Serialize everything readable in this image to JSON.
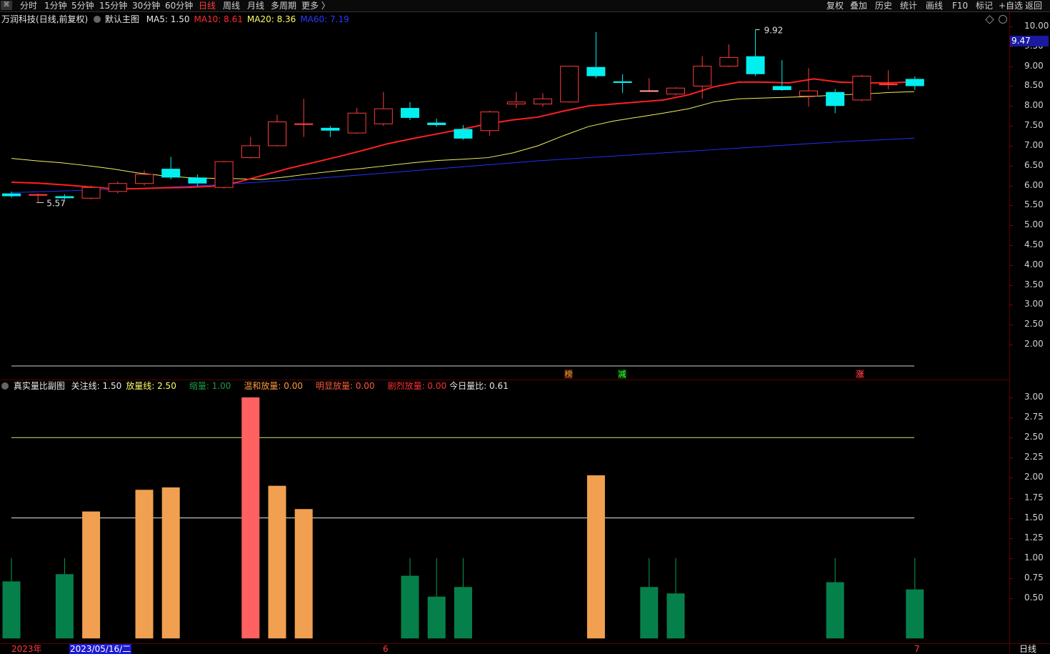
{
  "toolbar": {
    "logo": "⌘",
    "left_items": [
      "分时",
      "1分钟",
      "5分钟",
      "15分钟",
      "30分钟",
      "60分钟",
      "日线",
      "周线",
      "月线",
      "多周期",
      "更多"
    ],
    "active": "日线",
    "right_items": [
      "复权",
      "叠加",
      "历史",
      "统计",
      "画线",
      "F10",
      "标记",
      "+自选",
      "返回"
    ]
  },
  "main_chart": {
    "stock_name": "万润科技",
    "mode": "(日线,前复权)",
    "indicator_name": "默认主图",
    "ma_labels": [
      {
        "text": "MA5: 1.50",
        "color": "#e8e8e8"
      },
      {
        "text": "MA10: 8.61",
        "color": "#ff2b2b"
      },
      {
        "text": "MA20: 8.36",
        "color": "#ffff66"
      },
      {
        "text": "MA60: 7.19",
        "color": "#2a3aff"
      }
    ],
    "high_label": "9.92",
    "low_label": "5.57",
    "last_price_tag": "9.47",
    "y_axis": [
      "10.00",
      "9.50",
      "9.00",
      "8.50",
      "8.00",
      "7.50",
      "7.00",
      "6.50",
      "6.00",
      "5.50",
      "5.00",
      "4.50",
      "4.00",
      "3.50",
      "3.00",
      "2.50",
      "2.00"
    ],
    "signals": [
      {
        "text": "榜",
        "color": "#ff9a3c",
        "bg": "#3a1a00"
      },
      {
        "text": "减",
        "color": "#3cff3c",
        "bg": "#003a00"
      },
      {
        "text": "涨",
        "color": "#ff5a5a",
        "bg": "#3a0000"
      }
    ]
  },
  "chart_data": {
    "type": "candlestick",
    "ylim": [
      1.5,
      10.1
    ],
    "candles": [
      {
        "o": 5.8,
        "c": 5.73,
        "h": 5.85,
        "l": 5.7
      },
      {
        "o": 5.77,
        "c": 5.77,
        "h": 5.8,
        "l": 5.57
      },
      {
        "o": 5.73,
        "c": 5.68,
        "h": 5.78,
        "l": 5.65
      },
      {
        "o": 5.68,
        "c": 5.95,
        "h": 6.0,
        "l": 5.65
      },
      {
        "o": 5.85,
        "c": 6.05,
        "h": 6.1,
        "l": 5.8
      },
      {
        "o": 6.05,
        "c": 6.28,
        "h": 6.38,
        "l": 6.0
      },
      {
        "o": 6.42,
        "c": 6.2,
        "h": 6.72,
        "l": 6.15
      },
      {
        "o": 6.2,
        "c": 6.05,
        "h": 6.28,
        "l": 5.98
      },
      {
        "o": 5.95,
        "c": 6.6,
        "h": 6.62,
        "l": 5.92
      },
      {
        "o": 6.7,
        "c": 7.0,
        "h": 7.22,
        "l": 6.68
      },
      {
        "o": 7.0,
        "c": 7.6,
        "h": 7.78,
        "l": 6.98
      },
      {
        "o": 7.55,
        "c": 7.55,
        "h": 8.18,
        "l": 7.22
      },
      {
        "o": 7.45,
        "c": 7.38,
        "h": 7.5,
        "l": 7.22
      },
      {
        "o": 7.32,
        "c": 7.82,
        "h": 7.95,
        "l": 7.3
      },
      {
        "o": 7.55,
        "c": 7.93,
        "h": 8.35,
        "l": 7.5
      },
      {
        "o": 7.95,
        "c": 7.7,
        "h": 8.1,
        "l": 7.65
      },
      {
        "o": 7.58,
        "c": 7.52,
        "h": 7.68,
        "l": 7.48
      },
      {
        "o": 7.42,
        "c": 7.18,
        "h": 7.52,
        "l": 7.15
      },
      {
        "o": 7.38,
        "c": 7.85,
        "h": 7.88,
        "l": 7.25
      },
      {
        "o": 8.05,
        "c": 8.1,
        "h": 8.35,
        "l": 7.95
      },
      {
        "o": 8.05,
        "c": 8.18,
        "h": 8.32,
        "l": 7.98
      },
      {
        "o": 8.1,
        "c": 9.0,
        "h": 9.0,
        "l": 8.08
      },
      {
        "o": 8.98,
        "c": 8.75,
        "h": 9.86,
        "l": 8.7
      },
      {
        "o": 8.62,
        "c": 8.58,
        "h": 8.8,
        "l": 8.33
      },
      {
        "o": 8.38,
        "c": 8.38,
        "h": 8.7,
        "l": 8.38
      },
      {
        "o": 8.3,
        "c": 8.45,
        "h": 8.47,
        "l": 8.26
      },
      {
        "o": 8.5,
        "c": 9.0,
        "h": 9.25,
        "l": 8.18
      },
      {
        "o": 9.0,
        "c": 9.22,
        "h": 9.55,
        "l": 8.98
      },
      {
        "o": 9.25,
        "c": 8.8,
        "h": 9.92,
        "l": 8.75
      },
      {
        "o": 8.5,
        "c": 8.4,
        "h": 9.15,
        "l": 8.38
      },
      {
        "o": 8.25,
        "c": 8.38,
        "h": 8.95,
        "l": 7.98
      },
      {
        "o": 8.35,
        "c": 8.0,
        "h": 8.43,
        "l": 7.82
      },
      {
        "o": 8.15,
        "c": 8.75,
        "h": 8.78,
        "l": 8.12
      },
      {
        "o": 8.55,
        "c": 8.55,
        "h": 8.9,
        "l": 8.42
      },
      {
        "o": 8.68,
        "c": 8.5,
        "h": 8.75,
        "l": 8.4
      }
    ],
    "ma10": [
      6.08,
      6.06,
      6.02,
      5.97,
      5.92,
      5.92,
      5.94,
      5.95,
      5.98,
      6.08,
      6.25,
      6.42,
      6.57,
      6.72,
      6.88,
      7.05,
      7.18,
      7.3,
      7.42,
      7.55,
      7.65,
      7.72,
      7.87,
      8.0,
      8.05,
      8.1,
      8.15,
      8.28,
      8.48,
      8.6,
      8.6,
      8.58,
      8.68,
      8.6,
      8.58,
      8.58,
      8.61
    ],
    "ma20": [
      6.68,
      6.62,
      6.57,
      6.5,
      6.42,
      6.32,
      6.25,
      6.2,
      6.18,
      6.17,
      6.15,
      6.22,
      6.3,
      6.37,
      6.43,
      6.5,
      6.57,
      6.63,
      6.66,
      6.7,
      6.82,
      7.0,
      7.25,
      7.48,
      7.62,
      7.72,
      7.82,
      7.93,
      8.1,
      8.18,
      8.2,
      8.22,
      8.24,
      8.28,
      8.3,
      8.34,
      8.36
    ],
    "ma60": [
      5.82,
      5.84,
      5.86,
      5.88,
      5.9,
      5.92,
      5.95,
      5.98,
      6.01,
      6.05,
      6.09,
      6.13,
      6.17,
      6.22,
      6.27,
      6.32,
      6.37,
      6.42,
      6.47,
      6.52,
      6.57,
      6.62,
      6.66,
      6.7,
      6.74,
      6.78,
      6.82,
      6.86,
      6.9,
      6.94,
      6.98,
      7.02,
      7.06,
      7.1,
      7.13,
      7.16,
      7.19
    ]
  },
  "sub_chart": {
    "title": "真实量比副图",
    "labels": [
      {
        "text": "关注线: 1.50",
        "color": "#e8e8e8"
      },
      {
        "text": "放量线: 2.50",
        "color": "#ffff66"
      },
      {
        "text": "缩量: 1.00",
        "color": "#1a9a4a"
      },
      {
        "text": "温和放量: 0.00",
        "color": "#ff9a3c"
      },
      {
        "text": "明显放量: 0.00",
        "color": "#ff5a3c"
      },
      {
        "text": "剧烈放量: 0.00",
        "color": "#ff3030"
      },
      {
        "text": "今日量比: 0.61",
        "color": "#e8e8e8"
      }
    ],
    "y_axis": [
      "3.00",
      "2.75",
      "2.50",
      "2.25",
      "2.00",
      "1.75",
      "1.50",
      "1.25",
      "1.00",
      "0.75",
      "0.50"
    ],
    "ylim": [
      0.0,
      3.0
    ],
    "guide_lines": [
      2.5,
      1.5
    ],
    "volume_ratio": [
      0.71,
      null,
      0.8,
      1.58,
      null,
      1.85,
      1.88,
      null,
      null,
      3.0,
      1.9,
      1.61,
      null,
      null,
      null,
      0.78,
      0.52,
      0.64,
      null,
      null,
      null,
      null,
      2.03,
      null,
      0.64,
      0.56,
      null,
      null,
      null,
      null,
      null,
      0.7,
      null,
      null,
      0.61
    ],
    "bar_colors": [
      "green",
      "green",
      "green",
      "orange",
      "orange",
      "orange",
      "orange",
      "orange",
      "orange",
      "red",
      "orange",
      "orange",
      "orange",
      "orange",
      "orange",
      "green",
      "green",
      "green",
      "green",
      "green",
      "green",
      "green",
      "orange",
      "green",
      "green",
      "green",
      "green",
      "green",
      "green",
      "green",
      "green",
      "green",
      "green",
      "green",
      "green"
    ]
  },
  "date_axis": {
    "year_label": "2023年",
    "cursor_date": "2023/05/16/二",
    "month_6": "6",
    "month_7": "7",
    "period": "日线"
  }
}
